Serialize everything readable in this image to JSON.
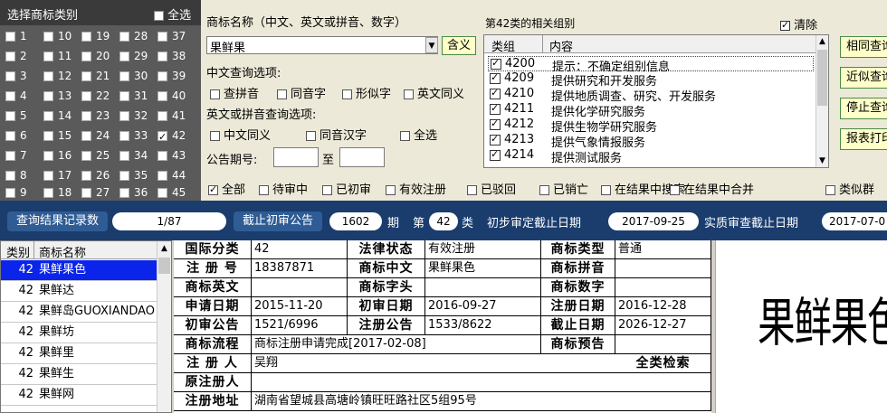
{
  "class_panel": {
    "title": "选择商标类别",
    "select_all": "全选",
    "classes": [
      "1",
      "2",
      "3",
      "4",
      "5",
      "6",
      "7",
      "8",
      "9",
      "10",
      "11",
      "12",
      "13",
      "14",
      "15",
      "16",
      "17",
      "18",
      "19",
      "20",
      "21",
      "22",
      "23",
      "24",
      "25",
      "26",
      "27",
      "28",
      "29",
      "30",
      "31",
      "32",
      "33",
      "34",
      "35",
      "36",
      "37",
      "38",
      "39",
      "40",
      "41",
      "42",
      "43",
      "44",
      "45"
    ],
    "checked": [
      "42"
    ]
  },
  "search": {
    "name_label": "商标名称（中文、英文或拼音、数字）",
    "name_value": "果鲜果",
    "meaning_button": "含义",
    "chinese_options_label": "中文查询选项:",
    "chinese_options": [
      "查拼音",
      "同音字",
      "形似字",
      "英文同义"
    ],
    "english_options_label": "英文或拼音查询选项:",
    "english_options": [
      "中文同义",
      "同音汉字",
      "全选"
    ],
    "issue_label": "公告期号:",
    "to_label": "至"
  },
  "groups": {
    "title": "第42类的相关组别",
    "clear_label": "清除",
    "header_group": "类组",
    "header_content": "内容",
    "rows": [
      {
        "code": "4200",
        "desc": "提示：不确定组别信息"
      },
      {
        "code": "4209",
        "desc": "提供研究和开发服务"
      },
      {
        "code": "4210",
        "desc": "提供地质调查、研究、开发服务"
      },
      {
        "code": "4211",
        "desc": "提供化学研究服务"
      },
      {
        "code": "4212",
        "desc": "提供生物学研究服务"
      },
      {
        "code": "4213",
        "desc": "提供气象情报服务"
      },
      {
        "code": "4214",
        "desc": "提供测试服务"
      }
    ]
  },
  "side_buttons": [
    "相同查询",
    "近似查询",
    "停止查询",
    "报表打印"
  ],
  "filters": {
    "items": [
      "全部",
      "待审中",
      "已初审",
      "有效注册",
      "已驳回",
      "已销亡",
      "在结果中搜索",
      "在结果中合并",
      "类似群"
    ],
    "checked": [
      "全部"
    ]
  },
  "status_bar": {
    "records_label": "查询结果记录数",
    "records_value": "1/87",
    "deadline_label": "截止初审公告",
    "deadline_value": "1602",
    "issue_unit": "期",
    "class_prefix": "第",
    "class_value": "42",
    "class_suffix": "类",
    "initial_label": "初步审定截止日期",
    "initial_value": "2017-09-25",
    "substantive_label": "实质审查截止日期",
    "substantive_value": "2017-07-0"
  },
  "results": {
    "header_class": "类别",
    "header_name": "商标名称",
    "rows": [
      {
        "cls": "42",
        "name": "果鲜果色",
        "selected": true
      },
      {
        "cls": "42",
        "name": "果鲜达"
      },
      {
        "cls": "42",
        "name": "果鲜岛GUOXIANDAO"
      },
      {
        "cls": "42",
        "name": "果鲜坊"
      },
      {
        "cls": "42",
        "name": "果鲜里"
      },
      {
        "cls": "42",
        "name": "果鲜生"
      },
      {
        "cls": "42",
        "name": "果鲜网"
      }
    ]
  },
  "detail": {
    "intl_class_label": "国际分类",
    "intl_class_value": "42",
    "legal_status_label": "法律状态",
    "legal_status_value": "有效注册",
    "type_label": "商标类型",
    "type_value": "普通",
    "reg_no_label": "注 册 号",
    "reg_no_value": "18387871",
    "cn_label": "商标中文",
    "cn_value": "果鲜果色",
    "pinyin_label": "商标拼音",
    "pinyin_value": "",
    "en_label": "商标英文",
    "en_value": "",
    "letter_label": "商标字头",
    "letter_value": "",
    "digit_label": "商标数字",
    "digit_value": "",
    "apply_date_label": "申请日期",
    "apply_date_value": "2015-11-20",
    "initial_date_label": "初审日期",
    "initial_date_value": "2016-09-27",
    "reg_date_label": "注册日期",
    "reg_date_value": "2016-12-28",
    "initial_pub_label": "初审公告",
    "initial_pub_value": "1521/6996",
    "reg_pub_label": "注册公告",
    "reg_pub_value": "1533/8622",
    "expire_label": "截止日期",
    "expire_value": "2026-12-27",
    "flow_label": "商标流程",
    "flow_value": "商标注册申请完成[2017-02-08]",
    "warning_label": "商标预告",
    "registrant_label": "注 册 人",
    "registrant_value": "吴翔",
    "all_class_search": "全类检索",
    "original_registrant_label": "原注册人",
    "original_registrant_value": "",
    "address_label": "注册地址",
    "address_value": "湖南省望城县高塘岭镇旺旺路社区5组95号"
  },
  "preview": {
    "text": "果鲜果色"
  }
}
